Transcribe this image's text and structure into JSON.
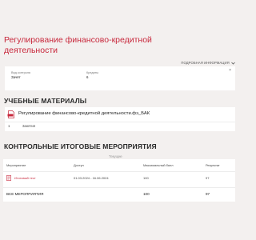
{
  "page": {
    "title": "Регулирование финансово-кредитной деятельности",
    "details_link": "ПОДРОБНАЯ ИНФОРМАЦИЯ",
    "details_icon": "chevron-down-icon"
  },
  "info_card": {
    "control_type_label": "Вид контроля",
    "control_type_value": "Зачёт",
    "credits_label": "Кредиты",
    "credits_value": "6",
    "close_glyph": "×"
  },
  "materials": {
    "heading": "УЧЕБНЫЕ МАТЕРИАЛЫ",
    "document_title": "Регулирование финансово-кредитной деятельности.фэ_БАК",
    "document_icon": "pdf-document-icon",
    "lesson_number": "1",
    "lesson_label": "Занятия"
  },
  "events": {
    "heading": "КОНТРОЛЬНЫЕ ИТОГОВЫЕ МЕРОПРИЯТИЯ",
    "current_tab": "Текущие",
    "columns": [
      "Мероприятие",
      "Доступ",
      "Максимальный балл",
      "Результат"
    ],
    "rows": [
      {
        "name": "Итоговый тест",
        "access": "01.03.2024 - 16.06.2024",
        "max_score": "100",
        "result": "97"
      }
    ],
    "total": {
      "label": "ВСЕ МЕРОПРИЯТИЯ",
      "max_score": "100",
      "result": "97"
    }
  },
  "colors": {
    "accent": "#c8283c",
    "background": "#f3f0ef",
    "card": "#ffffff"
  }
}
